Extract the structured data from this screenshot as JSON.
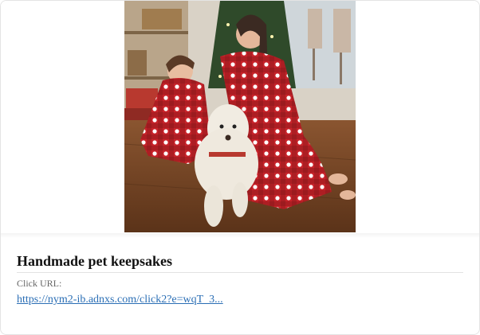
{
  "ad": {
    "image_alt": "Mother, daughter and white dog wearing matching red plaid pet-face pajamas by a Christmas tree",
    "title": "Handmade pet keepsakes",
    "click_url_label": "Click URL:",
    "click_url": "https://nym2-ib.adnxs.com/click2?e=wqT_3..."
  },
  "colors": {
    "link": "#2a6eb5",
    "pajama_red": "#c8232a",
    "floor": "#6b3f22"
  }
}
